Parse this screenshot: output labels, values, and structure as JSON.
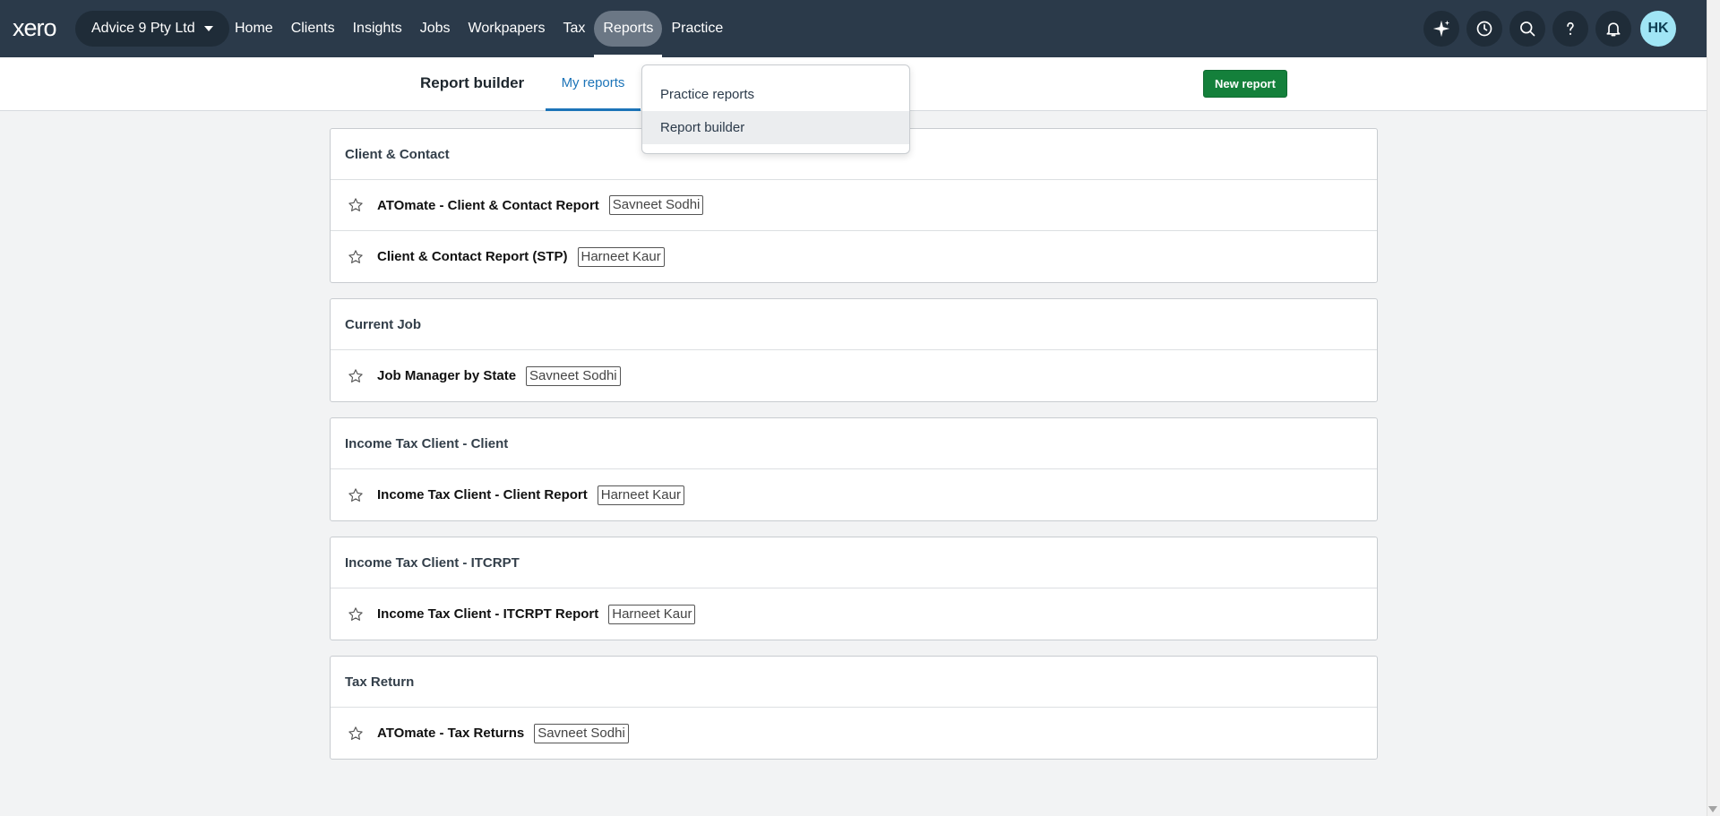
{
  "nav": {
    "logo": "xero",
    "org": "Advice 9 Pty Ltd",
    "items": [
      {
        "label": "Home",
        "name": "nav-home"
      },
      {
        "label": "Clients",
        "name": "nav-clients"
      },
      {
        "label": "Insights",
        "name": "nav-insights"
      },
      {
        "label": "Jobs",
        "name": "nav-jobs"
      },
      {
        "label": "Workpapers",
        "name": "nav-workpapers"
      },
      {
        "label": "Tax",
        "name": "nav-tax"
      },
      {
        "label": "Reports",
        "name": "nav-reports",
        "active": true
      },
      {
        "label": "Practice",
        "name": "nav-practice"
      }
    ],
    "avatar": "HK"
  },
  "subheader": {
    "title": "Report builder",
    "tab": "My reports",
    "new_report": "New report"
  },
  "dropdown": {
    "items": [
      "Practice reports",
      "Report builder"
    ],
    "highlighted": "Report builder"
  },
  "sections": [
    {
      "title": "Client & Contact",
      "rows": [
        {
          "name": "ATOmate - Client & Contact Report",
          "owner": "Savneet Sodhi"
        },
        {
          "name": "Client & Contact Report (STP)",
          "owner": "Harneet Kaur"
        }
      ]
    },
    {
      "title": "Current Job",
      "rows": [
        {
          "name": "Job Manager by State",
          "owner": "Savneet Sodhi"
        }
      ]
    },
    {
      "title": "Income Tax Client - Client",
      "rows": [
        {
          "name": "Income Tax Client - Client Report",
          "owner": "Harneet Kaur"
        }
      ]
    },
    {
      "title": "Income Tax Client - ITCRPT",
      "rows": [
        {
          "name": "Income Tax Client - ITCRPT Report",
          "owner": "Harneet Kaur"
        }
      ]
    },
    {
      "title": "Tax Return",
      "rows": [
        {
          "name": "ATOmate - Tax Returns",
          "owner": "Savneet Sodhi"
        }
      ]
    }
  ],
  "colors": {
    "nav_bg": "#2b3a4a",
    "accent_blue": "#1c74b8",
    "button_green": "#14803b"
  }
}
